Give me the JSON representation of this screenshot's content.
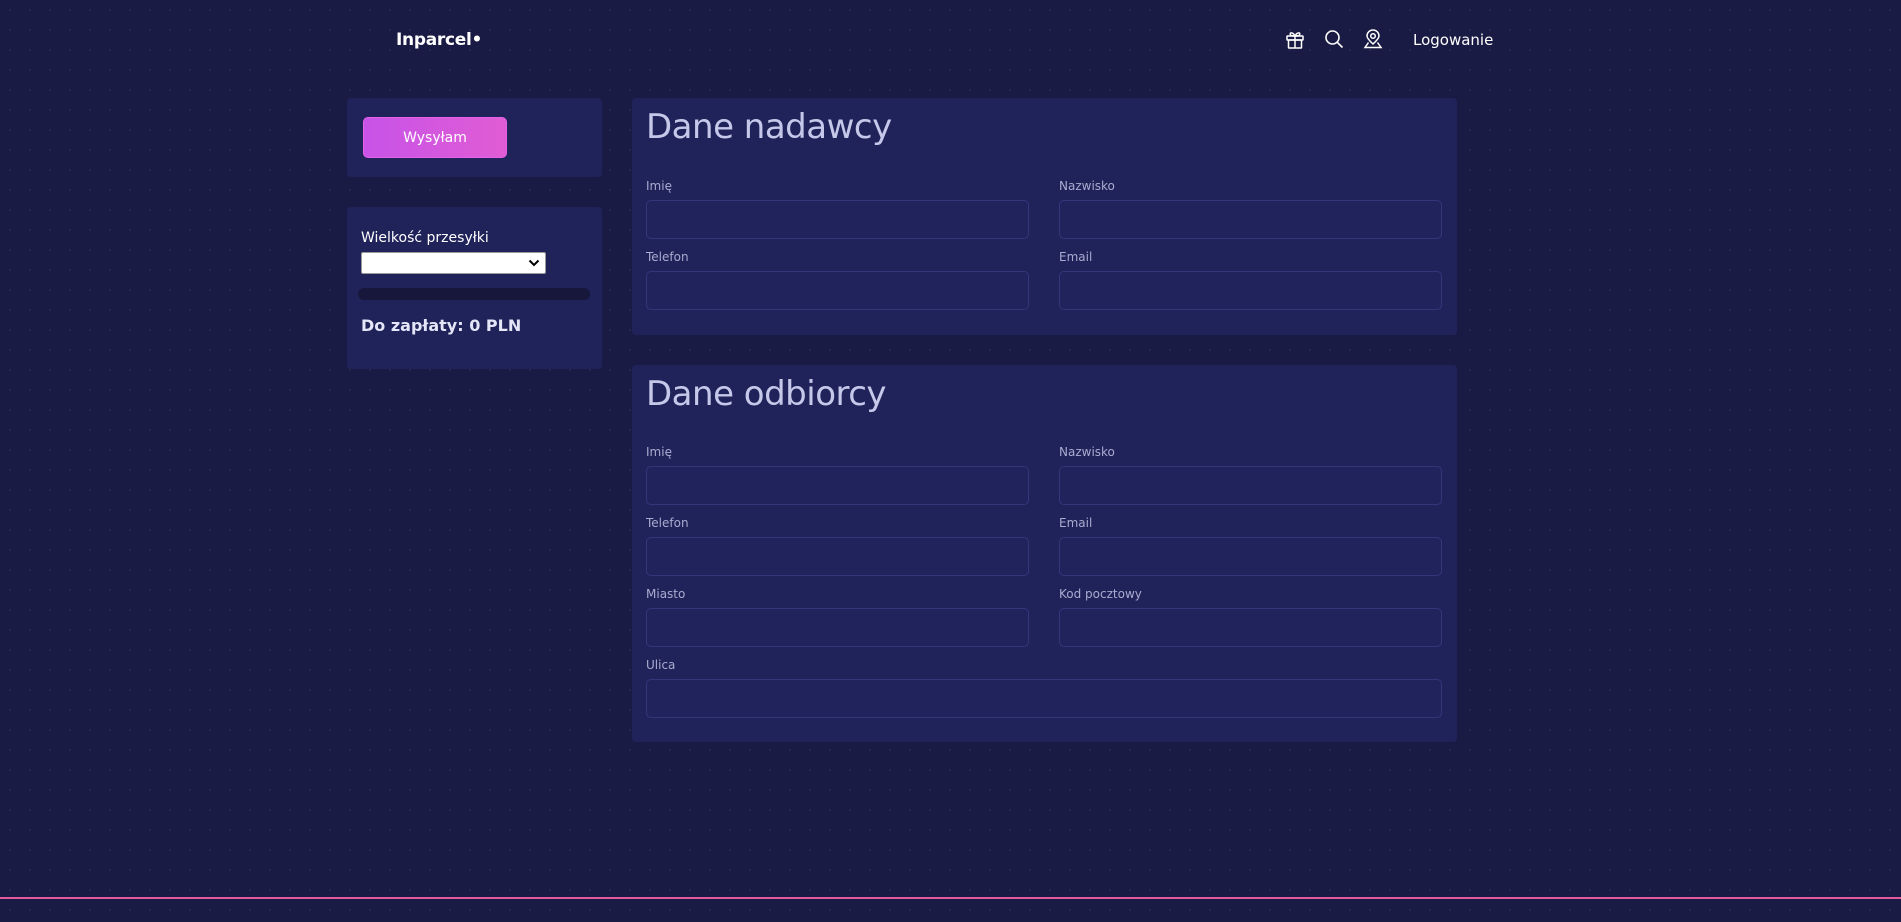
{
  "header": {
    "logo": "Inparcel•",
    "login_label": "Logowanie",
    "icons": [
      "gift-icon",
      "search-icon",
      "location-pin-icon"
    ]
  },
  "sidebar": {
    "send_button_label": "Wysyłam",
    "size_label": "Wielkość przesyłki",
    "size_selected": "",
    "progress_percent": 0,
    "total_label": "Do zapłaty: 0 PLN"
  },
  "sender": {
    "title": "Dane nadawcy",
    "fields": {
      "first_name": {
        "label": "Imię",
        "value": ""
      },
      "last_name": {
        "label": "Nazwisko",
        "value": ""
      },
      "phone": {
        "label": "Telefon",
        "value": ""
      },
      "email": {
        "label": "Email",
        "value": ""
      }
    }
  },
  "recipient": {
    "title": "Dane odbiorcy",
    "fields": {
      "first_name": {
        "label": "Imię",
        "value": ""
      },
      "last_name": {
        "label": "Nazwisko",
        "value": ""
      },
      "phone": {
        "label": "Telefon",
        "value": ""
      },
      "email": {
        "label": "Email",
        "value": ""
      },
      "city": {
        "label": "Miasto",
        "value": ""
      },
      "postal_code": {
        "label": "Kod pocztowy",
        "value": ""
      },
      "street": {
        "label": "Ulica",
        "value": ""
      }
    }
  },
  "colors": {
    "background": "#1a1b44",
    "panel": "#20225a",
    "accent": "#d158e0",
    "footer_line": "#e45a9c"
  }
}
